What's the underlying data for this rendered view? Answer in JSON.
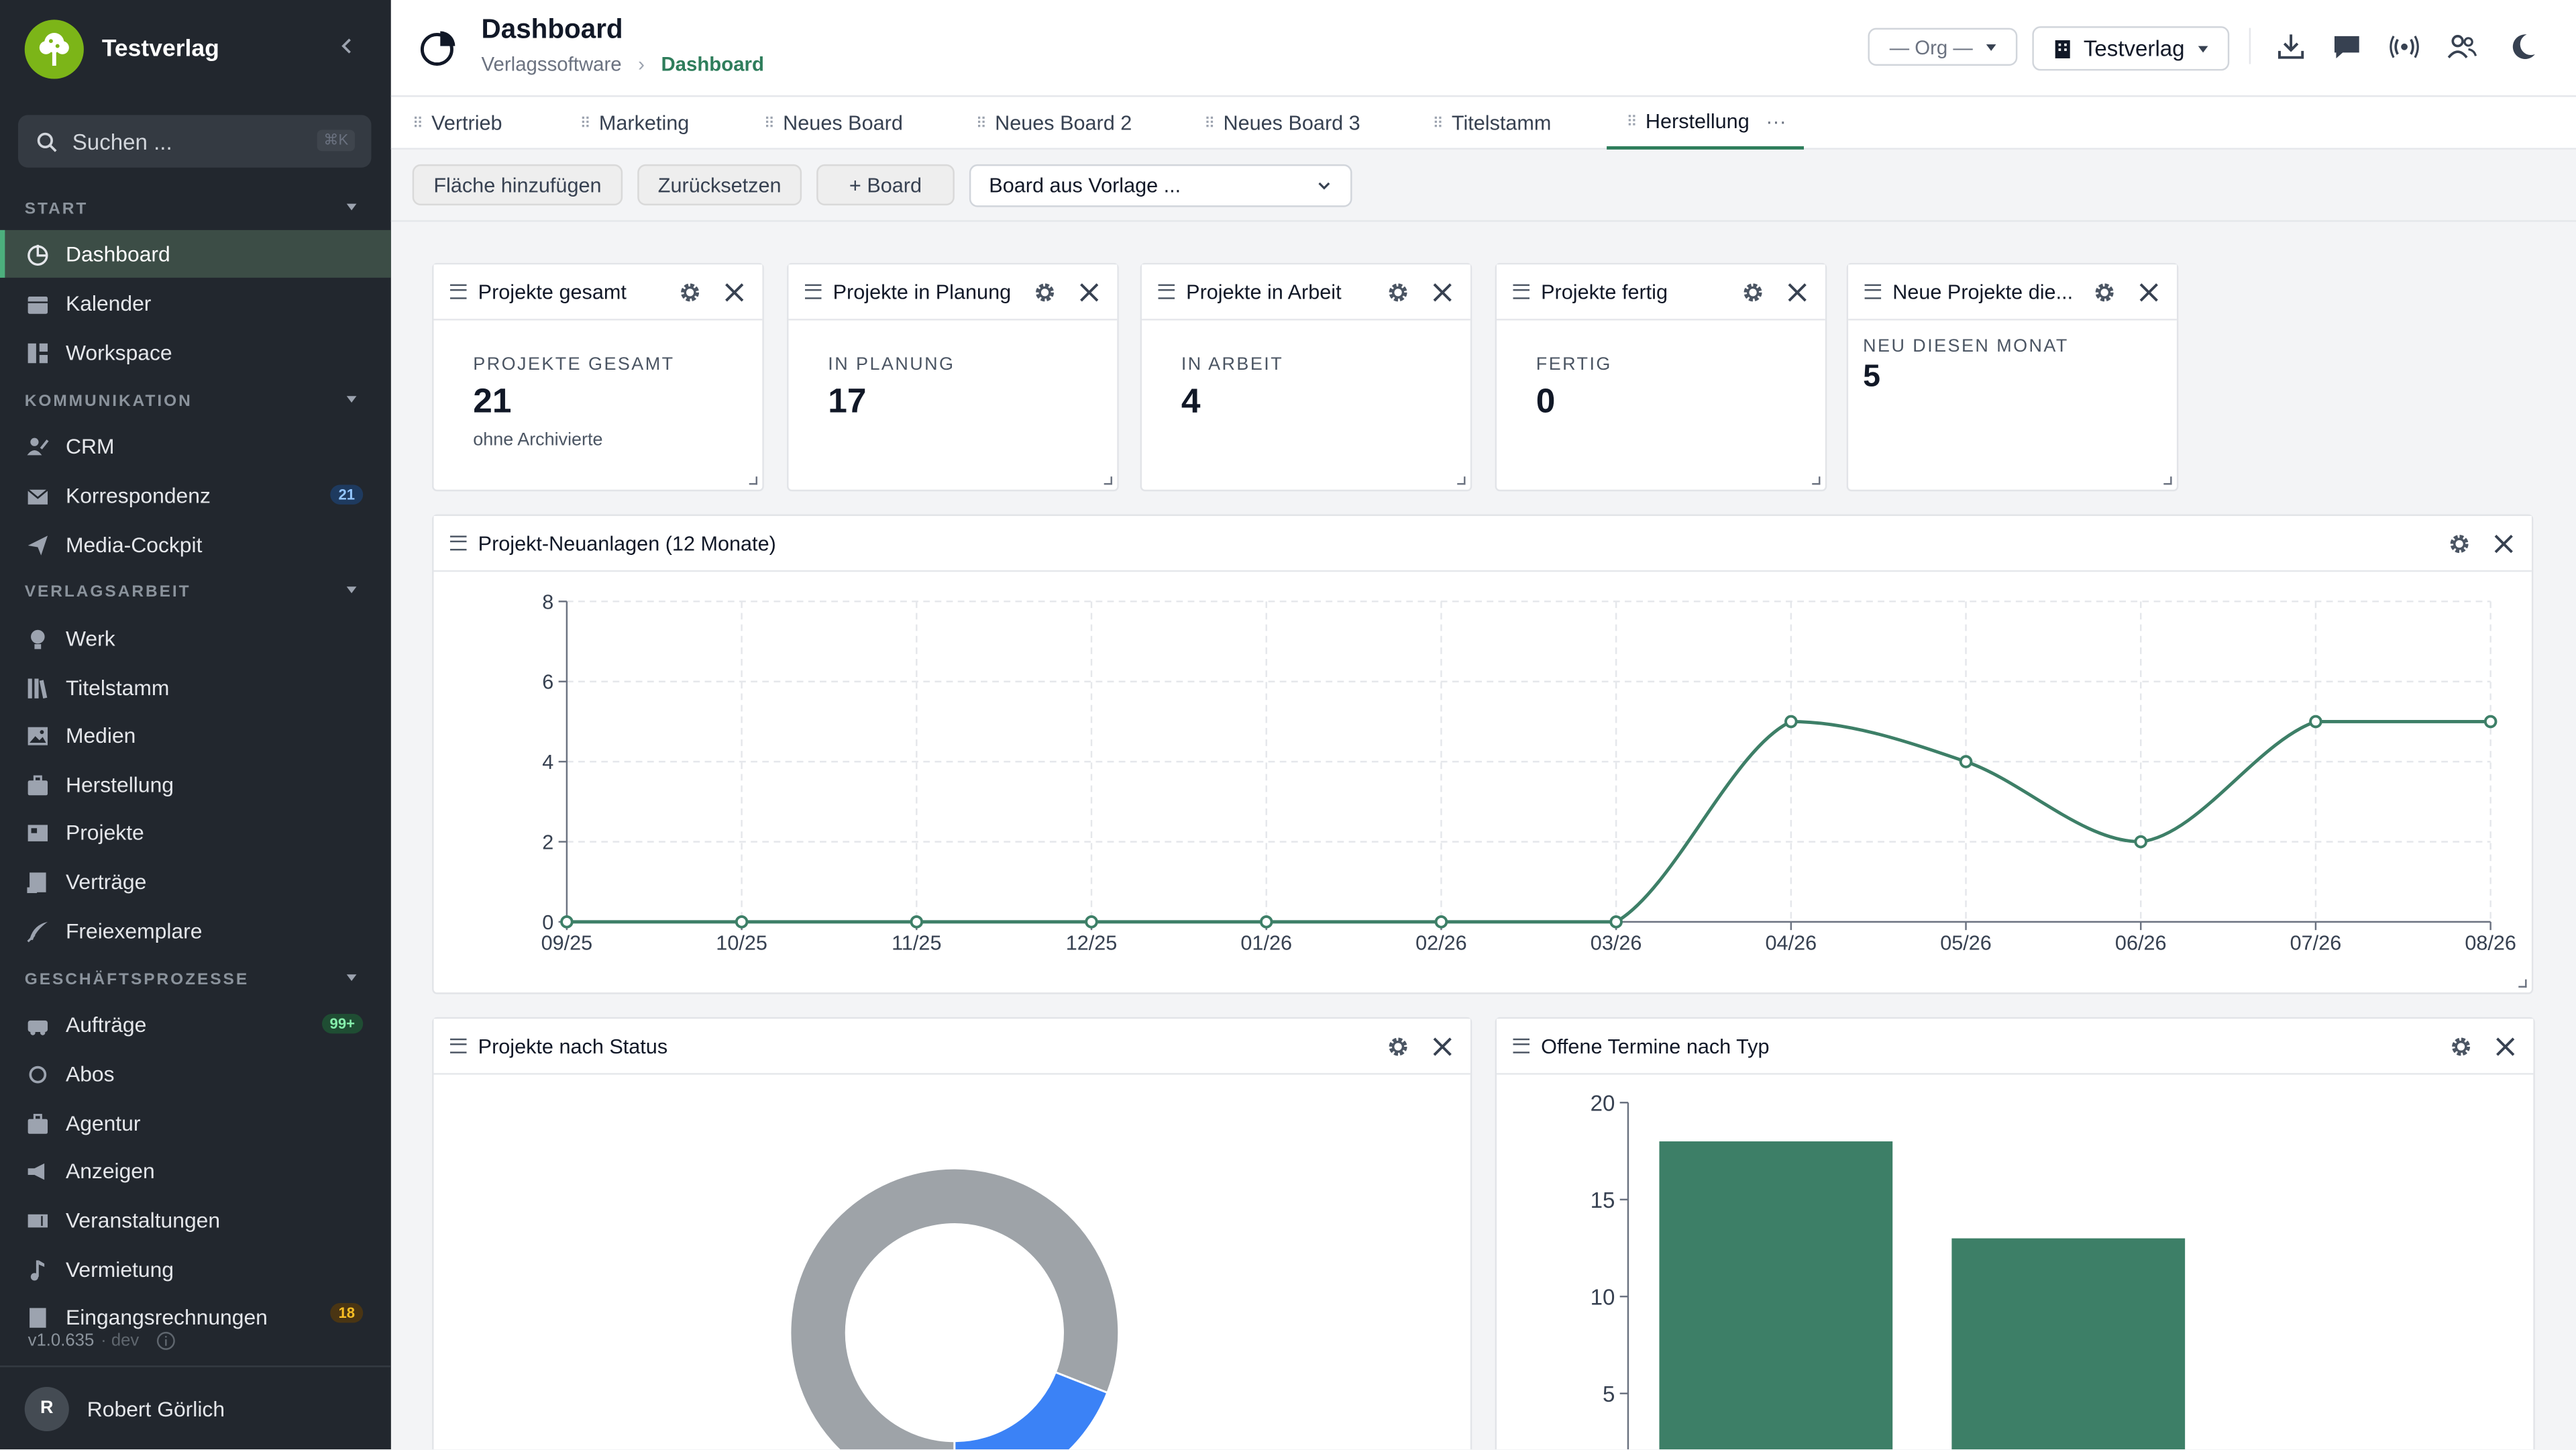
{
  "app": {
    "name": "Testverlag"
  },
  "search": {
    "placeholder": "Suchen ...",
    "shortcut": "⌘K"
  },
  "sidebar": {
    "sections": [
      {
        "label": "START"
      },
      {
        "label": "KOMMUNIKATION"
      },
      {
        "label": "VERLAGSARBEIT"
      },
      {
        "label": "GESCHÄFTSPROZESSE"
      }
    ],
    "items": [
      {
        "label": "Dashboard",
        "icon": "dashboard-icon",
        "active": true
      },
      {
        "label": "Kalender",
        "icon": "calendar-icon"
      },
      {
        "label": "Workspace",
        "icon": "workspace-icon"
      },
      {
        "label": "CRM",
        "icon": "users-icon"
      },
      {
        "label": "Korrespondenz",
        "icon": "mail-icon",
        "badge": "21",
        "badge_color": "#60a5fa"
      },
      {
        "label": "Media-Cockpit",
        "icon": "send-icon"
      },
      {
        "label": "Werk",
        "icon": "lightbulb-icon"
      },
      {
        "label": "Titelstamm",
        "icon": "books-icon"
      },
      {
        "label": "Medien",
        "icon": "image-icon"
      },
      {
        "label": "Herstellung",
        "icon": "briefcase-icon"
      },
      {
        "label": "Projekte",
        "icon": "project-icon"
      },
      {
        "label": "Verträge",
        "icon": "contract-icon"
      },
      {
        "label": "Freiexemplare",
        "icon": "feather-icon"
      },
      {
        "label": "Aufträge",
        "icon": "truck-icon",
        "badge": "99+",
        "badge_color": "#4ade80"
      },
      {
        "label": "Abos",
        "icon": "refresh-icon"
      },
      {
        "label": "Agentur",
        "icon": "suitcase-icon"
      },
      {
        "label": "Anzeigen",
        "icon": "megaphone-icon"
      },
      {
        "label": "Veranstaltungen",
        "icon": "ticket-icon"
      },
      {
        "label": "Vermietung",
        "icon": "music-icon"
      },
      {
        "label": "Eingangsrechnungen",
        "icon": "invoice-icon",
        "badge": "18",
        "badge_color": "#f59e0b"
      }
    ],
    "version": "v1.0.635",
    "env": "· dev",
    "user": {
      "initial": "R",
      "name": "Robert Görlich"
    }
  },
  "header": {
    "title": "Dashboard",
    "breadcrumb": [
      "Verlagssoftware",
      "Dashboard"
    ],
    "org_select": "— Org —",
    "tenant_select": "Testverlag"
  },
  "tabs": [
    {
      "label": "Vertrieb"
    },
    {
      "label": "Marketing"
    },
    {
      "label": "Neues Board"
    },
    {
      "label": "Neues Board 2"
    },
    {
      "label": "Neues Board 3"
    },
    {
      "label": "Titelstamm"
    },
    {
      "label": "Herstellung",
      "active": true,
      "more": "···"
    }
  ],
  "toolbar": {
    "add_area": "Fläche hinzufügen",
    "reset": "Zurücksetzen",
    "add_board": "+ Board",
    "template_select": "Board aus Vorlage ..."
  },
  "kpis": [
    {
      "title": "Projekte gesamt",
      "label": "PROJEKTE GESAMT",
      "value": "21",
      "sub": "ohne Archivierte"
    },
    {
      "title": "Projekte in Planung",
      "label": "IN PLANUNG",
      "value": "17"
    },
    {
      "title": "Projekte in Arbeit",
      "label": "IN ARBEIT",
      "value": "4"
    },
    {
      "title": "Projekte fertig",
      "label": "FERTIG",
      "value": "0"
    },
    {
      "title": "Neue Projekte die...",
      "label": "NEU DIESEN MONAT",
      "value": "5"
    }
  ],
  "line_widget": {
    "title": "Projekt-Neuanlagen (12 Monate)"
  },
  "donut_widget": {
    "title": "Projekte nach Status"
  },
  "bar_widget": {
    "title": "Offene Termine nach Typ"
  },
  "colors": {
    "accent": "#2e7d5b",
    "series": "#3d7f67",
    "donut_gray": "#9ea3a8",
    "donut_blue": "#3b82f6"
  },
  "chart_data": [
    {
      "type": "line",
      "x": [
        "09/25",
        "10/25",
        "11/25",
        "12/25",
        "01/26",
        "02/26",
        "03/26",
        "04/26",
        "05/26",
        "06/26",
        "07/26",
        "08/26"
      ],
      "values": [
        0,
        0,
        0,
        0,
        0,
        0,
        0,
        5,
        4,
        2,
        5,
        5
      ],
      "yticks": [
        0,
        2,
        4,
        6,
        8
      ],
      "ylim": [
        0,
        8
      ],
      "grid": true
    },
    {
      "type": "pie",
      "values": [
        17,
        4
      ],
      "colors": [
        "#9ea3a8",
        "#3b82f6"
      ]
    },
    {
      "type": "bar",
      "values": [
        18,
        13
      ],
      "yticks": [
        5,
        10,
        15,
        20
      ],
      "ylim": [
        0,
        20
      ]
    }
  ]
}
